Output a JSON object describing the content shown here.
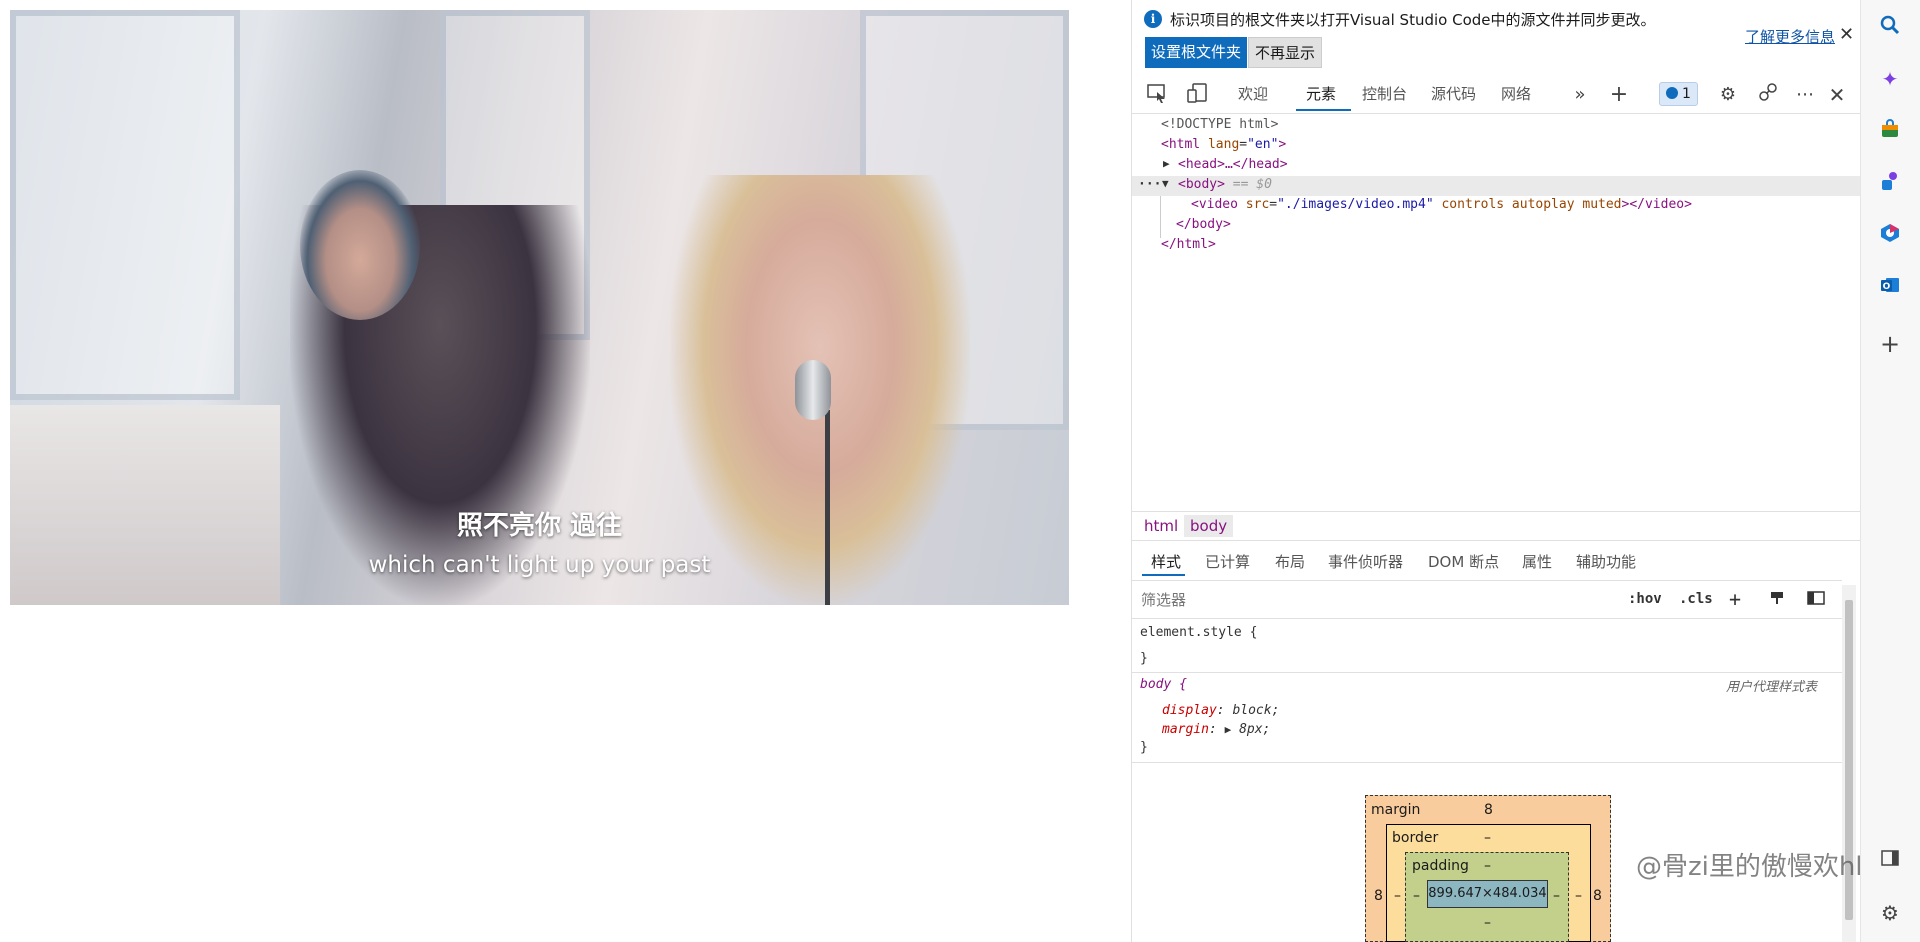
{
  "video": {
    "subtitle_zh": "照不亮你 過往",
    "subtitle_en": "which can't light up your past"
  },
  "infobar": {
    "message": "标识项目的根文件夹以打开Visual Studio Code中的源文件并同步更改。",
    "learn_more": "了解更多信息",
    "primary_button": "设置根文件夹",
    "secondary_button": "不再显示"
  },
  "toolbar": {
    "tabs": [
      "欢迎",
      "元素",
      "控制台",
      "源代码",
      "网络"
    ],
    "active_tab": "元素",
    "issues_count": "1"
  },
  "dom_tree": {
    "doctype": "<!DOCTYPE html>",
    "html_open": "<html ",
    "html_attr": "lang",
    "html_attr_val": "\"en\"",
    "html_close_bracket": ">",
    "head": "<head>…</head>",
    "body_open": "<body>",
    "body_marker": " == $0",
    "video_open": "<video ",
    "video_src_attr": "src",
    "video_src_val": "\"./images/video.mp4\"",
    "video_flags": " controls autoplay muted",
    "video_close": "></video>",
    "body_close": "</body>",
    "html_close": "</html>",
    "ellipsis": "···"
  },
  "breadcrumbs": [
    "html",
    "body"
  ],
  "styles_tabs": [
    "样式",
    "已计算",
    "布局",
    "事件侦听器",
    "DOM 断点",
    "属性",
    "辅助功能"
  ],
  "filter": {
    "placeholder": "筛选器",
    "hov": ":hov",
    "cls": ".cls"
  },
  "styles": {
    "element_style_open": "element.style {",
    "close_brace": "}",
    "body_selector": "body {",
    "user_agent_label": "用户代理样式表",
    "prop1_name": "display",
    "prop1_value": "block;",
    "prop2_name": "margin",
    "prop2_value": "8px;"
  },
  "box_model": {
    "margin_label": "margin",
    "margin_value": "8",
    "border_label": "border",
    "border_value": "–",
    "padding_label": "padding",
    "padding_value": "–",
    "content_size": "899.647×484.034",
    "side_margin": "8",
    "side_dash": "–"
  },
  "watermark": "@骨zi里的傲慢欢hhh",
  "colors": {
    "accent": "#0f6cbd",
    "tag": "#881280",
    "attr_name": "#994500",
    "attr_value": "#1a1aa6"
  }
}
